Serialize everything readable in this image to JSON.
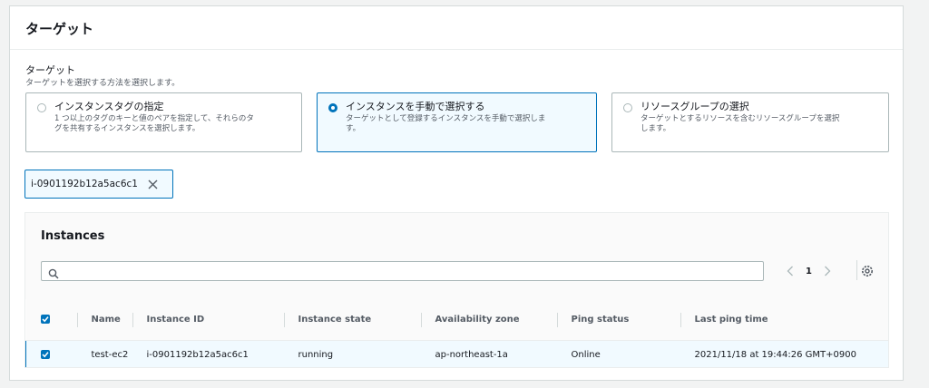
{
  "panel": {
    "title": "ターゲット"
  },
  "field": {
    "label": "ターゲット",
    "description": "ターゲットを選択する方法を選択します。"
  },
  "tiles": [
    {
      "label": "インスタンスタグの指定",
      "desc1": "1 つ以上のタグのキーと値のペアを指定して、それらのタ",
      "desc2": "グを共有するインスタンスを選択します。",
      "selected": false
    },
    {
      "label": "インスタンスを手動で選択する",
      "desc1": "ターゲットとして登録するインスタンスを手動で選択しま",
      "desc2": "す。",
      "selected": true
    },
    {
      "label": "リソースグループの選択",
      "desc1": "ターゲットとするリソースを含むリソースグループを選択",
      "desc2": "します。",
      "selected": false
    }
  ],
  "token": {
    "label": "i-0901192b12a5ac6c1"
  },
  "instances": {
    "title": "Instances",
    "search": {
      "value": "",
      "placeholder": ""
    },
    "pagination": {
      "page": "1"
    },
    "columns": [
      "Name",
      "Instance ID",
      "Instance state",
      "Availability zone",
      "Ping status",
      "Last ping time"
    ],
    "rows": [
      {
        "selected": true,
        "cells": [
          "test-ec2",
          "i-0901192b12a5ac6c1",
          "running",
          "ap-northeast-1a",
          "Online",
          "2021/11/18 at 19:44:26 GMT+0900"
        ]
      }
    ]
  },
  "colors": {
    "accent": "#0073bb",
    "border": "#aab7b8",
    "selected_bg": "#f1faff",
    "muted_text": "#545b64"
  },
  "icons": [
    "radio-icon",
    "close-icon",
    "search-icon",
    "chevron-left-icon",
    "chevron-right-icon",
    "gear-icon",
    "checkbox-icon"
  ]
}
